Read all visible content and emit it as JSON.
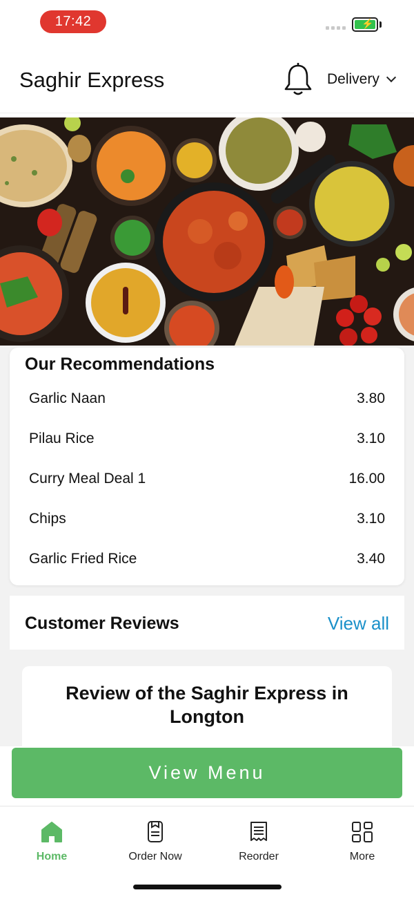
{
  "status_bar": {
    "time": "17:42"
  },
  "header": {
    "title": "Saghir Express",
    "delivery_label": "Delivery"
  },
  "hero": {
    "image_name": "indian-food-spread"
  },
  "recommendations": {
    "title": "Our Recommendations",
    "items": [
      {
        "name": "Garlic Naan",
        "price": "3.80"
      },
      {
        "name": "Pilau Rice",
        "price": "3.10"
      },
      {
        "name": "Curry Meal Deal 1",
        "price": "16.00"
      },
      {
        "name": "Chips",
        "price": "3.10"
      },
      {
        "name": "Garlic Fried Rice",
        "price": "3.40"
      }
    ]
  },
  "reviews": {
    "title": "Customer Reviews",
    "view_all_label": "View all",
    "card_title": "Review of the Saghir Express in Longton"
  },
  "view_menu_label": "View Menu",
  "tabs": [
    {
      "label": "Home",
      "icon": "home-icon",
      "active": true
    },
    {
      "label": "Order Now",
      "icon": "order-icon",
      "active": false
    },
    {
      "label": "Reorder",
      "icon": "receipt-icon",
      "active": false
    },
    {
      "label": "More",
      "icon": "grid-icon",
      "active": false
    }
  ],
  "colors": {
    "accent_green": "#5cb966",
    "link_blue": "#1a90c9",
    "time_pill_red": "#e0372f"
  }
}
